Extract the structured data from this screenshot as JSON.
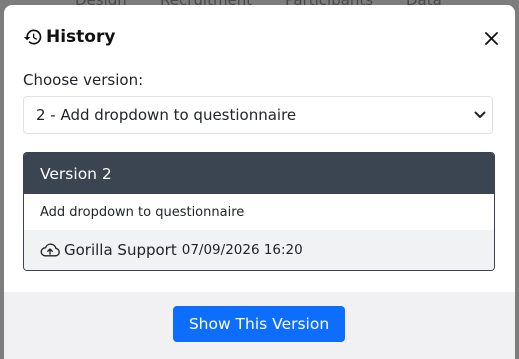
{
  "background": {
    "tabs": [
      "Design",
      "Recruitment",
      "Participants",
      "Data"
    ]
  },
  "modal": {
    "title": "History",
    "title_icon": "history-icon",
    "close_icon": "close-icon",
    "version_label": "Choose version:",
    "select": {
      "selected": "2 - Add dropdown to questionnaire"
    },
    "card": {
      "header": "Version 2",
      "description": "Add dropdown to questionnaire",
      "author": "Gorilla Support",
      "author_icon": "cloud-upload-icon",
      "timestamp": "07/09/2026 16:20"
    },
    "primary_button": "Show This Version"
  },
  "colors": {
    "primary": "#0d6efd",
    "card_header_bg": "#3b4451",
    "footer_bg": "#f1f1f3",
    "overlay_bg": "#7d7d7d"
  }
}
